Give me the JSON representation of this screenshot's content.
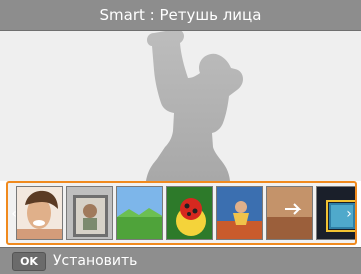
{
  "header": {
    "title": "Smart : Ретушь лица"
  },
  "strip": {
    "left_arrow": "‹",
    "right_arrow": "›",
    "items": [
      {
        "name": "beauty-shot-thumbnail"
      },
      {
        "name": "photo-frame-thumbnail"
      },
      {
        "name": "landscape-thumbnail"
      },
      {
        "name": "macro-thumbnail"
      },
      {
        "name": "action-thumbnail"
      },
      {
        "name": "panorama-thumbnail"
      },
      {
        "name": "night-thumbnail"
      }
    ]
  },
  "footer": {
    "ok_key": "OK",
    "ok_label": "Установить"
  },
  "colors": {
    "accent": "#f08a1e",
    "title_bg": "#8d8d8d"
  }
}
